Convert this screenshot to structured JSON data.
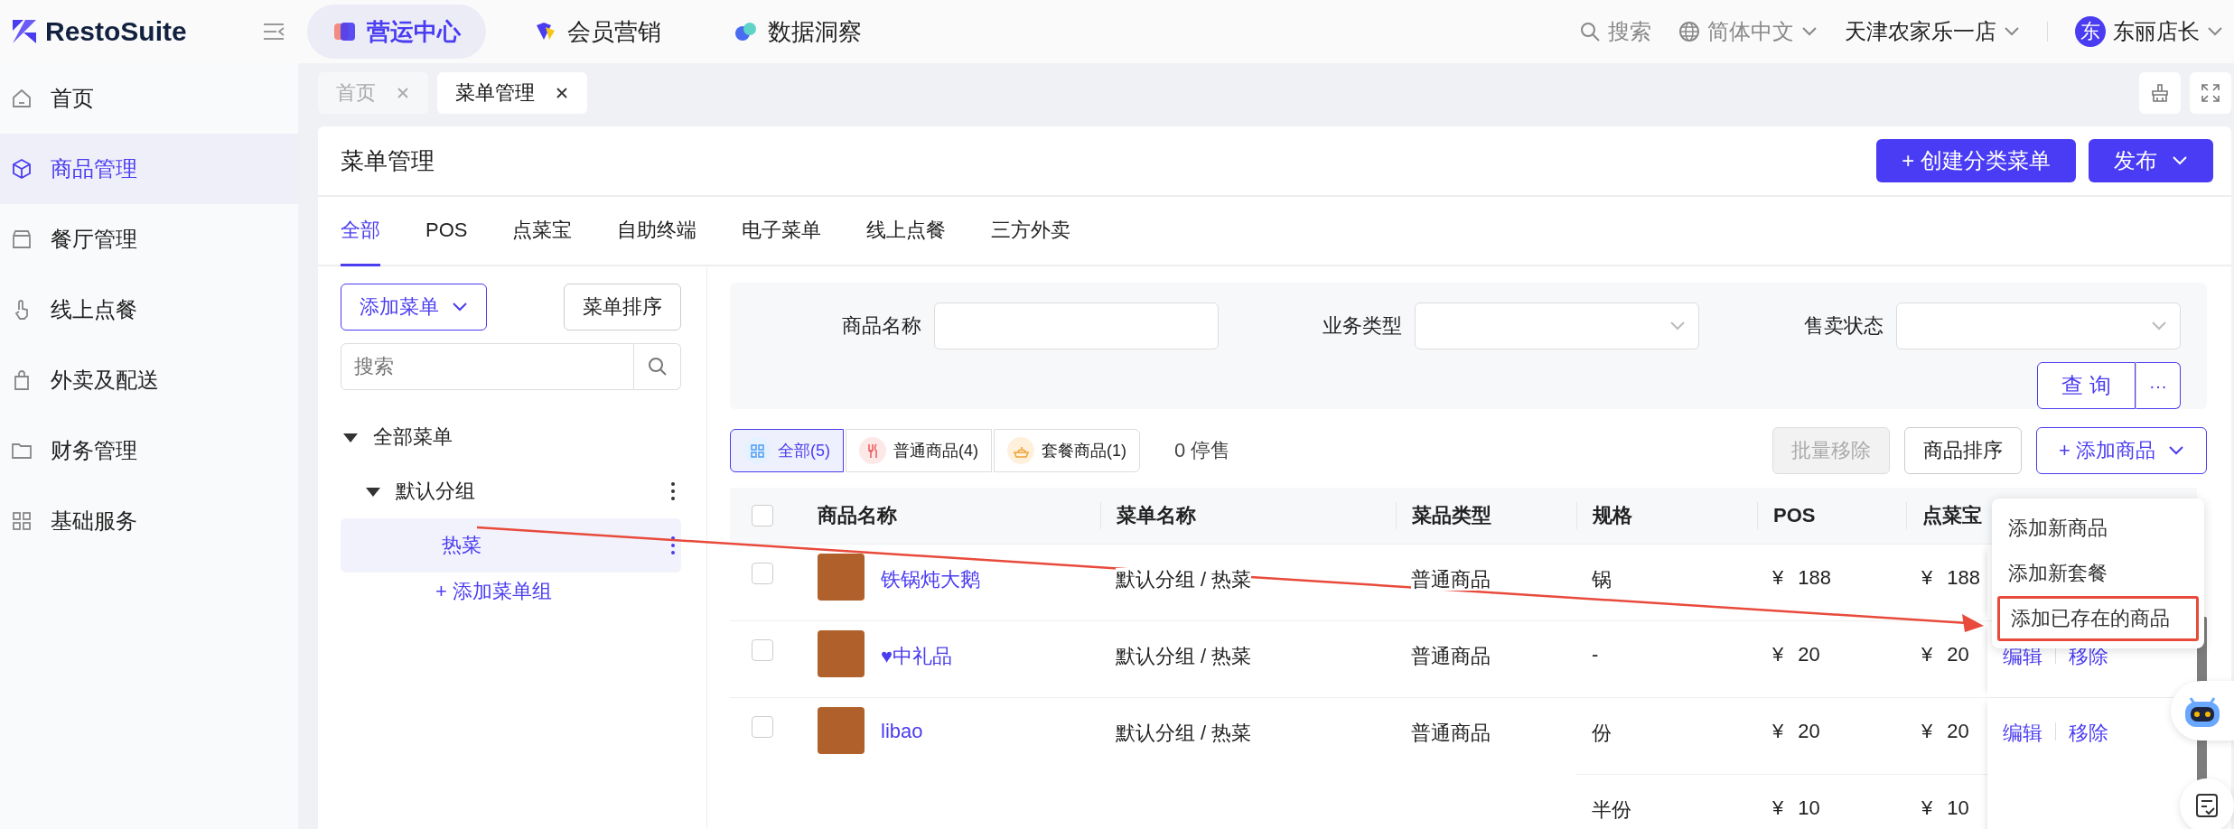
{
  "top_bar": {
    "logo": "RestoSuite",
    "modules": [
      {
        "label": "营运中心",
        "selected": true
      },
      {
        "label": "会员营销",
        "selected": false
      },
      {
        "label": "数据洞察",
        "selected": false
      }
    ],
    "search": "搜索",
    "language": "简体中文",
    "store": "天津农家乐一店",
    "user": {
      "avatar": "东",
      "name": "东丽店长"
    }
  },
  "sidebar": {
    "items": [
      {
        "label": "首页",
        "selected": false
      },
      {
        "label": "商品管理",
        "selected": true
      },
      {
        "label": "餐厅管理",
        "selected": false
      },
      {
        "label": "线上点餐",
        "selected": false
      },
      {
        "label": "外卖及配送",
        "selected": false
      },
      {
        "label": "财务管理",
        "selected": false
      },
      {
        "label": "基础服务",
        "selected": false
      }
    ]
  },
  "page_tabs": [
    {
      "label": "首页",
      "selected": false
    },
    {
      "label": "菜单管理",
      "selected": true
    }
  ],
  "page": {
    "title": "菜单管理",
    "buttons": [
      {
        "label": "+ 创建分类菜单",
        "has_caret": false
      },
      {
        "label": "发布",
        "has_caret": true
      }
    ]
  },
  "channel_tabs": [
    {
      "label": "全部",
      "selected": true
    },
    {
      "label": "POS",
      "selected": false
    },
    {
      "label": "点菜宝",
      "selected": false
    },
    {
      "label": "自助终端",
      "selected": false
    },
    {
      "label": "电子菜单",
      "selected": false
    },
    {
      "label": "线上点餐",
      "selected": false
    },
    {
      "label": "三方外卖",
      "selected": false
    }
  ],
  "menu_panel": {
    "add_button": "添加菜单",
    "sort_button": "菜单排序",
    "search_placeholder": "搜索",
    "tree": [
      {
        "label": "全部菜单",
        "expanded": true,
        "selected": false,
        "children": [
          {
            "label": "默认分组",
            "expanded": true,
            "selected": false,
            "children": [
              {
                "label": "热菜",
                "selected": true
              }
            ]
          }
        ]
      }
    ],
    "add_group": "+ 添加菜单组"
  },
  "filters": {
    "fields": [
      {
        "label": "商品名称",
        "kind": "text"
      },
      {
        "label": "业务类型",
        "kind": "select"
      },
      {
        "label": "售卖状态",
        "kind": "select"
      }
    ],
    "query_button": "查 询",
    "more_button": "···"
  },
  "type_tabs": [
    {
      "label": "全部(5)",
      "selected": true
    },
    {
      "label": "普通商品(4)",
      "selected": false
    },
    {
      "label": "套餐商品(1)",
      "selected": false
    }
  ],
  "stopped": "0 停售",
  "toolbar_buttons": [
    {
      "label": "批量移除",
      "disabled": true,
      "primary": false
    },
    {
      "label": "商品排序",
      "disabled": false,
      "primary": false
    },
    {
      "label": "+ 添加商品",
      "disabled": false,
      "primary": true
    }
  ],
  "table": {
    "header_checked": false,
    "columns": [
      "商品名称",
      "菜单名称",
      "菜品类型",
      "规格",
      "POS",
      "点菜宝"
    ],
    "rows": [
      {
        "checked": false,
        "name": "铁锅炖大鹅",
        "menu": "默认分组 / 热菜",
        "type": "普通商品",
        "specs": [
          {
            "spec": "锅",
            "pos": "¥ 188",
            "dcb": "¥ 188"
          }
        ],
        "actions": []
      },
      {
        "checked": false,
        "name": "♥中礼品",
        "menu": "默认分组 / 热菜",
        "type": "普通商品",
        "specs": [
          {
            "spec": "-",
            "pos": "¥ 20",
            "dcb": "¥ 20"
          }
        ],
        "actions": [
          "编辑",
          "移除"
        ]
      },
      {
        "checked": false,
        "name": "libao",
        "menu": "默认分组 / 热菜",
        "type": "普通商品",
        "specs": [
          {
            "spec": "份",
            "pos": "¥ 20",
            "dcb": "¥ 20"
          },
          {
            "spec": "半份",
            "pos": "¥ 10",
            "dcb": "¥ 10"
          }
        ],
        "actions": [
          "编辑",
          "移除"
        ]
      }
    ]
  },
  "add_dropdown": {
    "items": [
      {
        "label": "添加新商品",
        "highlighted": false
      },
      {
        "label": "添加新套餐",
        "highlighted": false
      },
      {
        "label": "添加已存在的商品",
        "highlighted": true
      }
    ]
  }
}
